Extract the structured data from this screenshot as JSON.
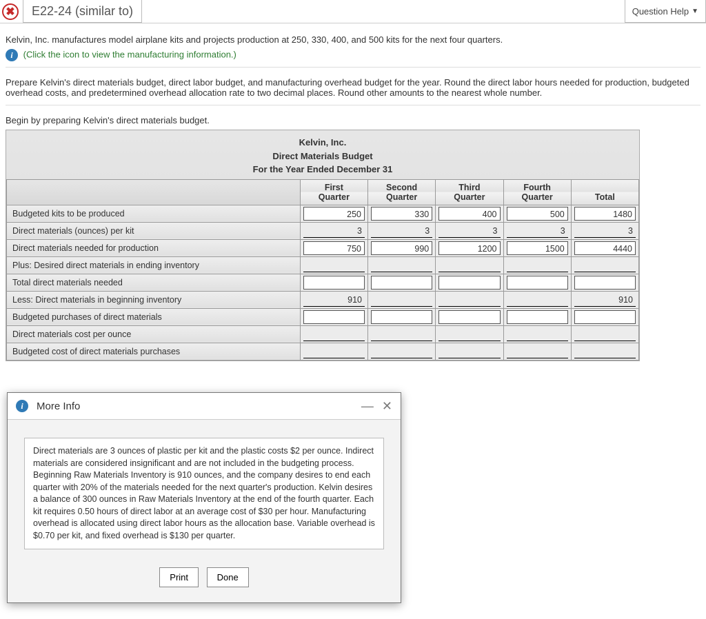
{
  "header": {
    "close_glyph": "✖",
    "title": "E22-24 (similar to)",
    "help_label": "Question Help",
    "help_caret": "▼"
  },
  "intro": {
    "line1": "Kelvin, Inc. manufactures model airplane kits and projects production at 250, 330, 400, and 500 kits for the next four quarters.",
    "info_glyph": "i",
    "click_text": "(Click the icon to view the manufacturing information.)",
    "instructions": "Prepare Kelvin's direct materials budget, direct labor budget, and manufacturing overhead budget for the year. Round the direct labor hours needed for production, budgeted overhead costs, and predetermined overhead allocation rate to two decimal places. Round other amounts to the nearest whole number.",
    "begin": "Begin by preparing Kelvin's direct materials budget."
  },
  "budget": {
    "company": "Kelvin, Inc.",
    "report": "Direct Materials Budget",
    "period": "For the Year Ended December 31",
    "col_top": [
      "First",
      "Second",
      "Third",
      "Fourth",
      ""
    ],
    "col_bot": [
      "Quarter",
      "Quarter",
      "Quarter",
      "Quarter",
      "Total"
    ],
    "rows": [
      {
        "label": "Budgeted kits to be produced",
        "style": "box",
        "vals": [
          "250",
          "330",
          "400",
          "500",
          "1480"
        ]
      },
      {
        "label": "Direct materials (ounces) per kit",
        "style": "underline",
        "vals": [
          "3",
          "3",
          "3",
          "3",
          "3"
        ]
      },
      {
        "label": "Direct materials needed for production",
        "style": "box",
        "vals": [
          "750",
          "990",
          "1200",
          "1500",
          "4440"
        ]
      },
      {
        "label": "Plus:   Desired direct materials in ending inventory",
        "style": "underline",
        "vals": [
          "",
          "",
          "",
          "",
          ""
        ]
      },
      {
        "label": "Total direct materials needed",
        "style": "box",
        "vals": [
          "",
          "",
          "",
          "",
          ""
        ]
      },
      {
        "label": "Less:   Direct materials in beginning inventory",
        "style": "underline",
        "vals": [
          "910",
          "",
          "",
          "",
          "910"
        ]
      },
      {
        "label": "Budgeted purchases of direct materials",
        "style": "box",
        "vals": [
          "",
          "",
          "",
          "",
          ""
        ]
      },
      {
        "label": "Direct materials cost per ounce",
        "style": "underline",
        "vals": [
          "",
          "",
          "",
          "",
          ""
        ]
      },
      {
        "label": "Budgeted cost of direct materials purchases",
        "style": "underline",
        "vals": [
          "",
          "",
          "",
          "",
          ""
        ]
      }
    ]
  },
  "dialog": {
    "info_glyph": "i",
    "title": "More Info",
    "min_glyph": "—",
    "close_glyph": "✕",
    "body": "Direct materials are 3 ounces of plastic per kit and the plastic costs $2 per ounce. Indirect materials are considered insignificant and are not included in the budgeting process. Beginning Raw Materials Inventory is 910 ounces, and the company desires to end each quarter with 20% of the materials needed for the next quarter's production. Kelvin desires a balance of 300 ounces in Raw Materials Inventory at the end of the fourth quarter. Each kit requires 0.50 hours of direct labor at an average cost of $30 per hour. Manufacturing overhead is allocated using direct labor hours as the allocation base. Variable overhead is $0.70 per kit, and fixed overhead is $130 per quarter.",
    "print": "Print",
    "done": "Done"
  }
}
